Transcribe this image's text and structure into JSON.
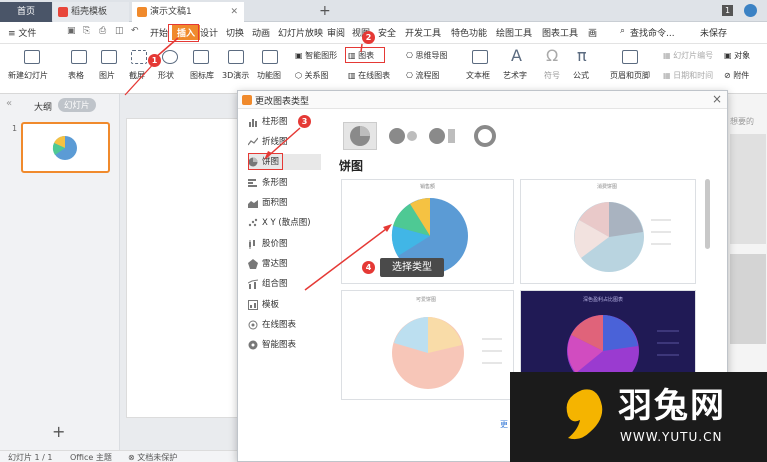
{
  "titlebar": {
    "tabs": [
      {
        "label": "首页"
      },
      {
        "label": "稻壳模板"
      },
      {
        "label": "演示文稿1"
      }
    ],
    "badge": "1"
  },
  "menubar": {
    "file": "≡ 文件",
    "items": [
      "开始",
      "插入",
      "设计",
      "切换",
      "动画",
      "幻灯片放映",
      "审阅",
      "视图",
      "安全",
      "开发工具",
      "特色功能",
      "绘图工具",
      "图表工具",
      "画"
    ],
    "search": "查找命令...",
    "unsaved": "未保存"
  },
  "toolbar": {
    "new_slide": "新建幻灯片",
    "table": "表格",
    "picture": "图片",
    "screenshot": "截屏",
    "shape": "形状",
    "iconlib": "图标库",
    "threed": "3D演示",
    "functions": "功能图",
    "smartart": "智能图形",
    "relation": "关系图",
    "chart": "图表",
    "online_chart": "在线图表",
    "mindmap": "思维导图",
    "flowchart": "流程图",
    "textbox": "文本框",
    "arttext": "艺术字",
    "symbol": "符号",
    "formula": "公式",
    "header_footer": "页眉和页脚",
    "slide_number": "幻灯片编号",
    "datetime": "日期和时间",
    "object": "对象",
    "attachment": "附件"
  },
  "leftpanel": {
    "outline": "大纲",
    "slides": "幻灯片",
    "slide_num": "1",
    "add": "+"
  },
  "statusbar": {
    "slide_info": "幻灯片 1 / 1",
    "theme": "Office 主题",
    "protect": "文档未保护"
  },
  "dialog": {
    "title": "更改图表类型",
    "close": "×",
    "categories": [
      "柱形图",
      "折线图",
      "饼图",
      "条形图",
      "面积图",
      "X Y (散点图)",
      "股价图",
      "雷达图",
      "组合图",
      "模板",
      "在线图表",
      "智能图表"
    ],
    "section_title": "饼图",
    "card_titles": [
      "销售额",
      "消费饼图",
      "可爱饼图",
      "深色盈利占比图表"
    ],
    "more": "更"
  },
  "annotations": {
    "badges": [
      "1",
      "2",
      "3",
      "4"
    ],
    "tooltip": "选择类型"
  },
  "rightstrip": {
    "text": "想要的"
  },
  "watermark": {
    "name": "羽兔网",
    "url": "WWW.YUTU.CN"
  },
  "colors": {
    "accent": "#f08a2c",
    "annotation": "#e53935",
    "pie_blue": "#5b9bd5",
    "pie_green": "#4ec994",
    "pie_yellow": "#f5c242"
  }
}
